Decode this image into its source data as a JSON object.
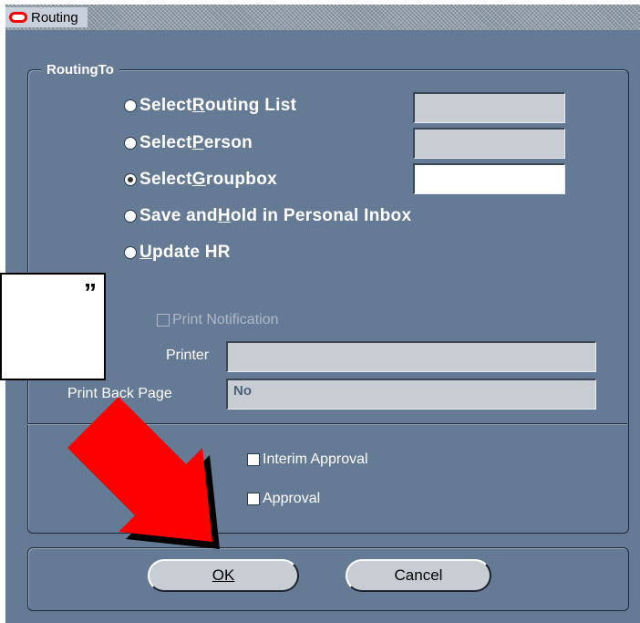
{
  "window": {
    "title": "Routing"
  },
  "routing_group": {
    "legend": "RoutingTo",
    "options": [
      {
        "pre": "Select ",
        "mn": "R",
        "post": "outing List",
        "selected": false
      },
      {
        "pre": "Select ",
        "mn": "P",
        "post": "erson",
        "selected": false
      },
      {
        "pre": "Select ",
        "mn": "G",
        "post": "roupbox",
        "selected": true
      },
      {
        "pre": "Save and ",
        "mn": "H",
        "post": "old in Personal Inbox",
        "selected": false
      },
      {
        "pre": "",
        "mn": "U",
        "post": "pdate HR",
        "selected": false
      }
    ]
  },
  "print": {
    "notification_label": "Print Notification",
    "printer_label": "Printer",
    "printer_value": "",
    "back_page_label": "Print Back Page",
    "back_page_value": "No"
  },
  "approvals": {
    "interim_label": "Interim Approval",
    "approval_label": "Approval"
  },
  "buttons": {
    "ok": "OK",
    "cancel": "Cancel"
  },
  "callout": {
    "quote_char": "”"
  },
  "colors": {
    "dialog_bg": "#657a94",
    "arrow": "#ff0000"
  }
}
